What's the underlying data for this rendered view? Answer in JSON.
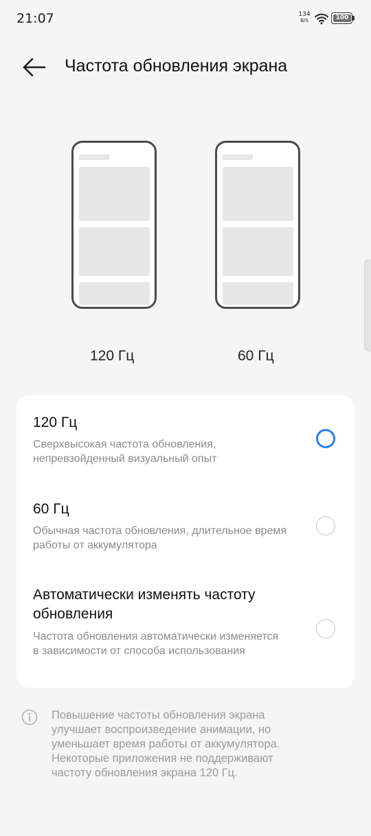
{
  "status_bar": {
    "time": "21:07",
    "net_speed_value": "134",
    "net_speed_unit": "B/S",
    "battery": "100"
  },
  "header": {
    "title": "Частота обновления экрана",
    "back_icon": "arrow-left-icon"
  },
  "previews": [
    {
      "label": "120 Гц"
    },
    {
      "label": "60 Гц"
    }
  ],
  "options": [
    {
      "title": "120 Гц",
      "description": "Сверхвысокая частота обновления, непревзойденный визуальный опыт",
      "selected": true
    },
    {
      "title": "60 Гц",
      "description": "Обычная частота обновления, длительное время работы от аккумулятора",
      "selected": false
    },
    {
      "title": "Автоматически изменять частоту обновления",
      "description": "Частота обновления автоматически изменяется в зависимости от способа использования",
      "selected": false
    }
  ],
  "info": {
    "icon": "info-icon",
    "text": "Повышение частоты обновления экрана улучшает воспроизведение анимации, но уменьшает время работы от аккумулятора. Некоторые приложения не поддерживают частоту обновления экрана 120 Гц."
  },
  "colors": {
    "accent": "#2a7cf0",
    "background": "#f5f5f5",
    "card": "#ffffff"
  }
}
